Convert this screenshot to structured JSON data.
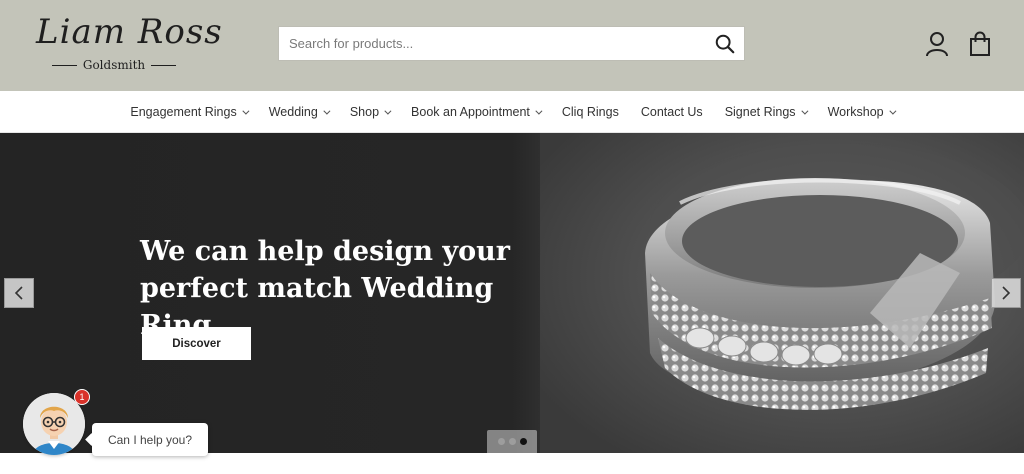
{
  "header": {
    "logo_script": "Liam Ross",
    "logo_sub": "Goldsmith",
    "search": {
      "placeholder": "Search for products...",
      "value": ""
    },
    "icons": [
      "search-icon",
      "account-icon",
      "cart-icon"
    ],
    "background_color": "#c3c4b9"
  },
  "nav": {
    "items": [
      {
        "label": "Engagement Rings",
        "has_dropdown": true
      },
      {
        "label": "Wedding",
        "has_dropdown": true
      },
      {
        "label": "Shop",
        "has_dropdown": true
      },
      {
        "label": "Book an Appointment",
        "has_dropdown": true
      },
      {
        "label": "Cliq Rings",
        "has_dropdown": false
      },
      {
        "label": "Contact Us",
        "has_dropdown": false
      },
      {
        "label": "Signet Rings",
        "has_dropdown": true
      },
      {
        "label": "Workshop",
        "has_dropdown": true
      }
    ]
  },
  "hero": {
    "title_line1": "We can help design your",
    "title_line2": "perfect match Wedding Ring",
    "cta_label": "Discover",
    "slides_total": 3,
    "active_slide": 3
  },
  "chat": {
    "badge_count": "1",
    "bubble_text": "Can I help you?",
    "badge_color": "#d9322a"
  }
}
